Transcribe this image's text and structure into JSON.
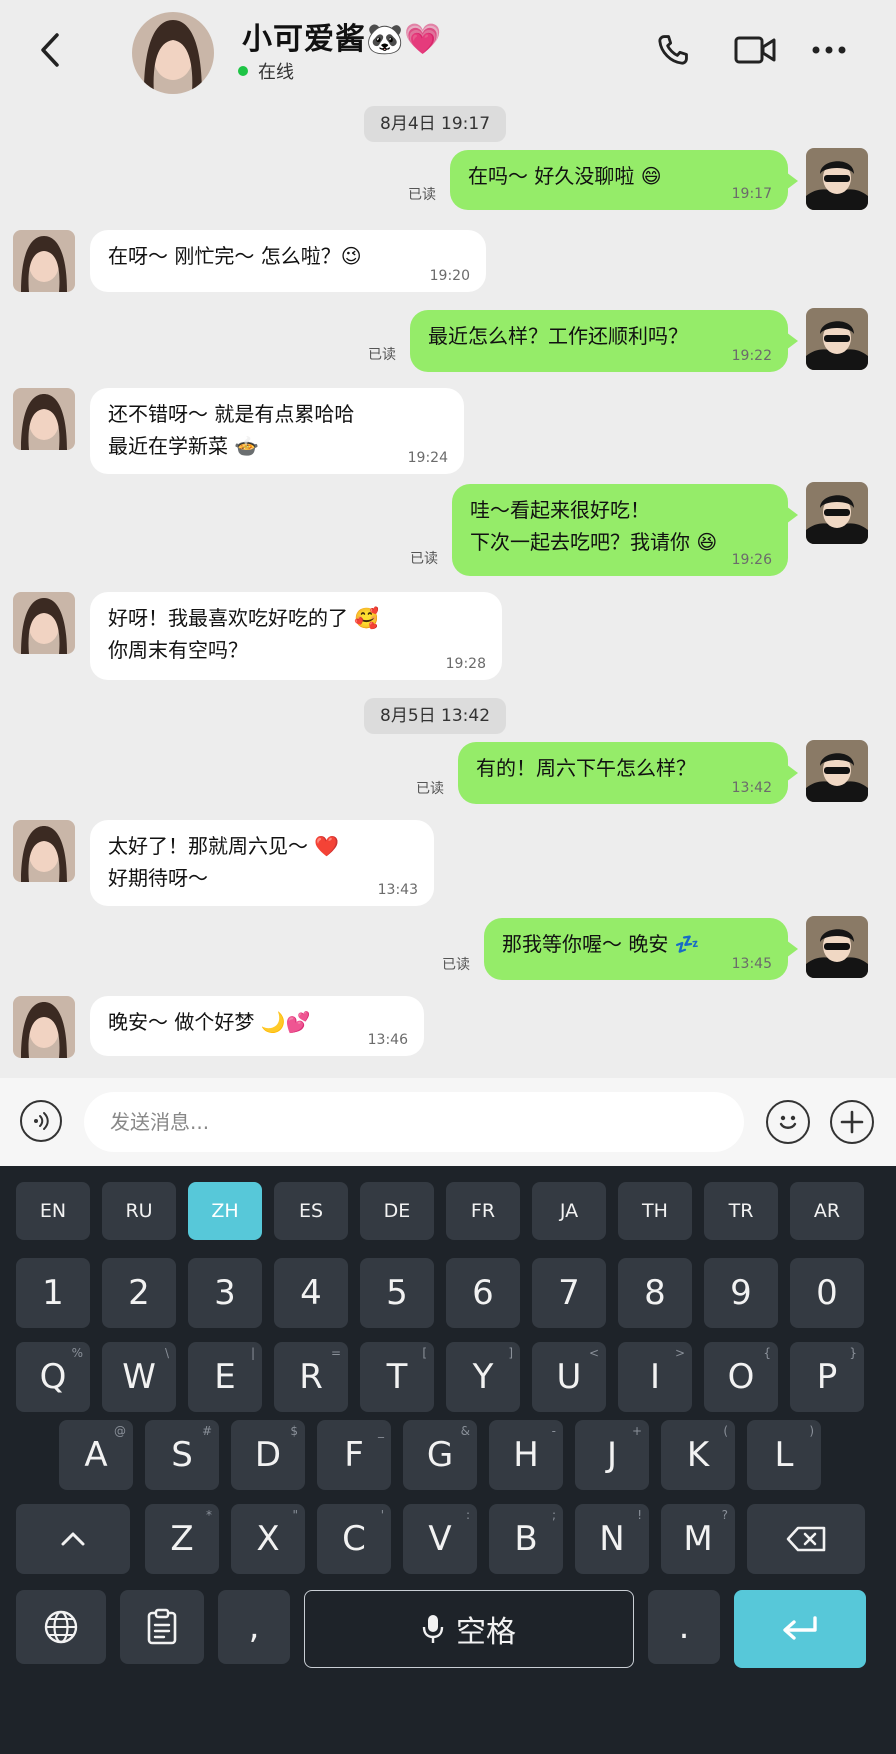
{
  "header": {
    "contact_name": "小可爱酱🐼💗",
    "status_text": "在线"
  },
  "messages": [
    {
      "type": "date",
      "text": "8月4日  19:17"
    },
    {
      "type": "out",
      "text": "在吗～ 好久没聊啦 😄",
      "time": "19:17",
      "read": "已读"
    },
    {
      "type": "in",
      "text": "在呀～ 刚忙完～ 怎么啦？😉",
      "time": "19:20"
    },
    {
      "type": "out",
      "text": "最近怎么样？工作还顺利吗？",
      "time": "19:22",
      "read": "已读"
    },
    {
      "type": "in",
      "line1": "还不错呀～ 就是有点累哈哈",
      "line2": "最近在学新菜 🍲",
      "time": "19:24"
    },
    {
      "type": "out",
      "line1": "哇～看起来很好吃！",
      "line2": "下次一起去吃吧？我请你 😆",
      "time": "19:26",
      "read": "已读"
    },
    {
      "type": "in",
      "line1": "好呀！我最喜欢吃好吃的了 🥰",
      "line2": "你周末有空吗？",
      "time": "19:28"
    },
    {
      "type": "date",
      "text": "8月5日  13:42"
    },
    {
      "type": "out",
      "text": "有的！周六下午怎么样？",
      "time": "13:42",
      "read": "已读"
    },
    {
      "type": "in",
      "line1": "太好了！那就周六见～ ❤️",
      "line2": "好期待呀～",
      "time": "13:43"
    },
    {
      "type": "out",
      "text": "那我等你喔～ 晚安 💤",
      "time": "13:45",
      "read": "已读"
    },
    {
      "type": "in",
      "text": "晚安～ 做个好梦 🌙💕",
      "time": "13:46"
    }
  ],
  "input": {
    "placeholder": "发送消息..."
  },
  "keyboard": {
    "languages": [
      "EN",
      "RU",
      "ZH",
      "ES",
      "DE",
      "FR",
      "JA",
      "TH",
      "TR",
      "AR"
    ],
    "active_language": "ZH",
    "numbers": [
      "1",
      "2",
      "3",
      "4",
      "5",
      "6",
      "7",
      "8",
      "9",
      "0"
    ],
    "row1": [
      "Q",
      "W",
      "E",
      "R",
      "T",
      "Y",
      "U",
      "I",
      "O",
      "P"
    ],
    "row1_sub": [
      "%",
      "\\",
      "|",
      "=",
      "[",
      "]",
      "<",
      ">",
      "{",
      "}"
    ],
    "row2": [
      "A",
      "S",
      "D",
      "F",
      "G",
      "H",
      "J",
      "K",
      "L"
    ],
    "row2_sub": [
      "@",
      "#",
      "$",
      "_",
      "&",
      "-",
      "+",
      "(",
      ")"
    ],
    "row3": [
      "Z",
      "X",
      "C",
      "V",
      "B",
      "N",
      "M"
    ],
    "row3_sub": [
      "*",
      "\"",
      "'",
      ":",
      ";",
      "!",
      "?"
    ],
    "comma": ",",
    "period": ".",
    "space_label": "空格"
  },
  "colors": {
    "outgoing_bubble": "#95ec69",
    "incoming_bubble": "#ffffff",
    "keyboard_accent": "#57c8d9",
    "online_dot": "#1ec445"
  }
}
